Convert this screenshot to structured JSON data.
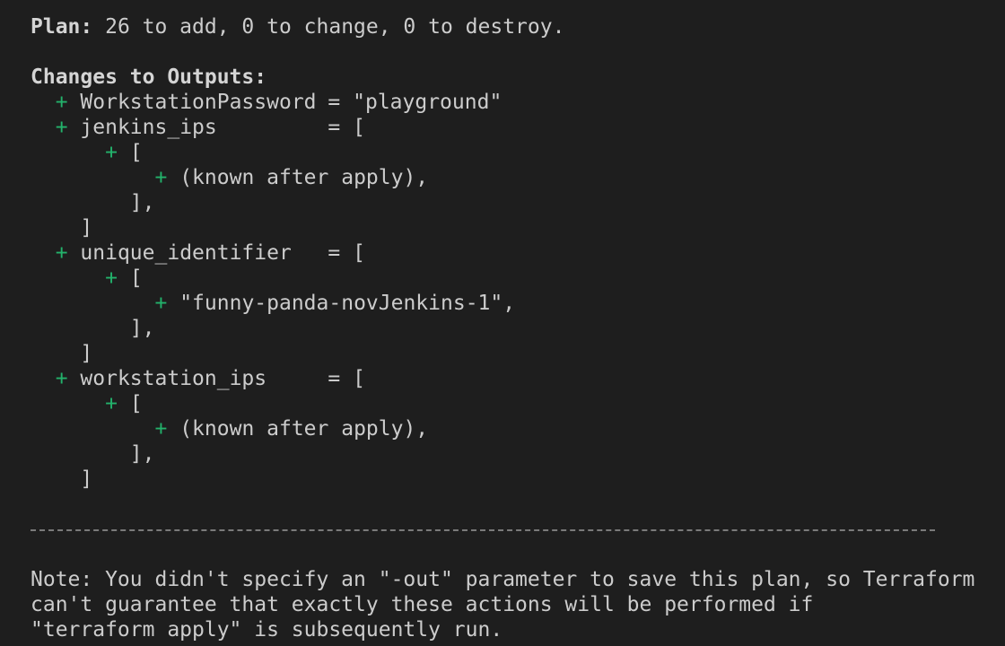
{
  "summary": {
    "label": "Plan:",
    "text": " 26 to add, 0 to change, 0 to destroy."
  },
  "outputs_header": "Changes to Outputs:",
  "plus": "+",
  "outputs": [
    {
      "name": "WorkstationPassword",
      "op": "= ",
      "value": "\"playground\""
    },
    {
      "name": "jenkins_ips",
      "op": "= ",
      "value": "["
    },
    {
      "name": "unique_identifier",
      "op": "= ",
      "value": "["
    },
    {
      "name": "workstation_ips",
      "op": "= ",
      "value": "["
    }
  ],
  "brackets": {
    "open": "[",
    "inner_close": "],",
    "close": "]"
  },
  "values": {
    "jenkins_ips": "(known after apply),",
    "unique_identifier": "\"funny-panda-novJenkins-1\",",
    "workstation_ips": "(known after apply),"
  },
  "note": {
    "line1": "Note: You didn't specify an \"-out\" parameter to save this plan, so Terraform",
    "line2": "can't guarantee that exactly these actions will be performed if",
    "line3": "\"terraform apply\" is subsequently run."
  }
}
